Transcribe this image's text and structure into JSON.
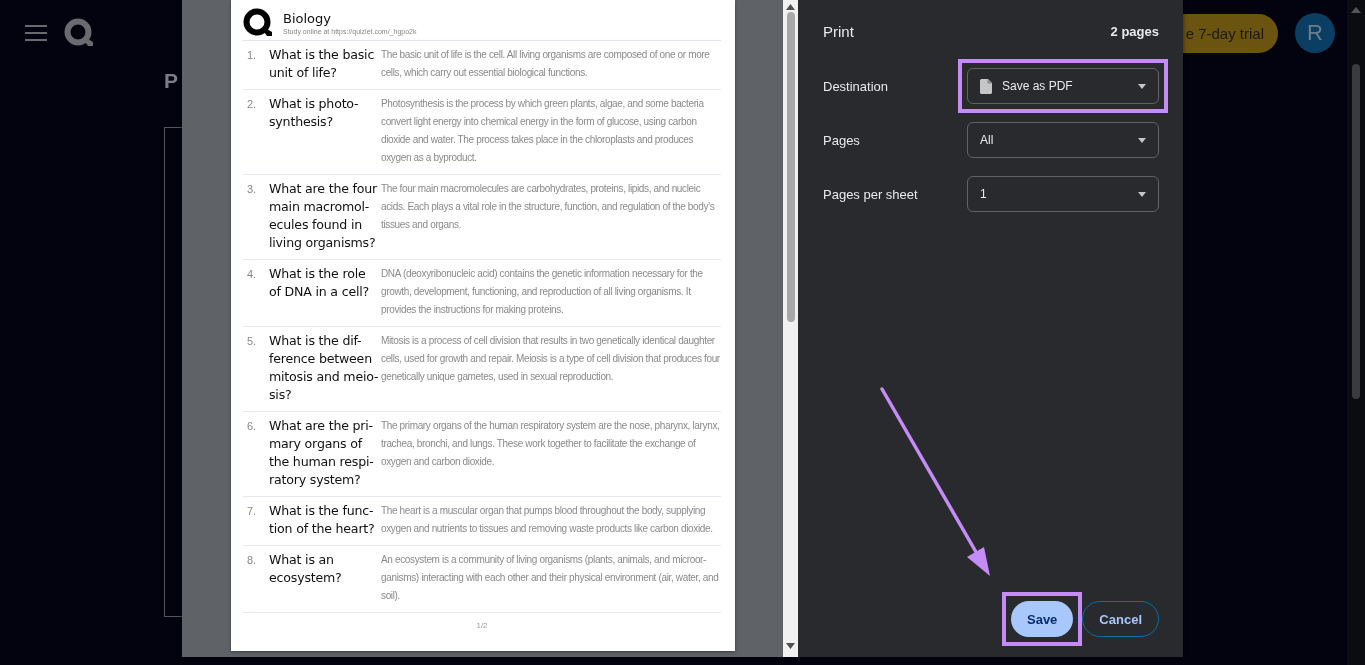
{
  "background_page": {
    "title_fragment": "P",
    "trial_button": "e 7-day trial",
    "avatar": "R"
  },
  "preview": {
    "document": {
      "title": "Biology",
      "subtitle": "Study online at https://quizlet.com/_hgpo2k",
      "items": [
        {
          "number": "1.",
          "question": "What is the basic unit of life?",
          "answer": "The basic unit of life is the cell. All living organisms are composed of one or more cells, which carry out essential biological functions."
        },
        {
          "number": "2.",
          "question": "What is photo-synthesis?",
          "answer": "Photosynthesis is the process by which green plants, algae, and some bacteria convert light energy into chemical energy in the form of glucose, using carbon dioxide and water. The process takes place in the chloroplasts and produces oxygen as a byproduct."
        },
        {
          "number": "3.",
          "question": "What are the four main macromol-ecules found in living organisms?",
          "answer": "The four main macromolecules are carbohydrates, proteins, lipids, and nucleic acids. Each plays a vital role in the structure, function, and regulation of the body's tissues and organs."
        },
        {
          "number": "4.",
          "question": "What is the role of DNA in a cell?",
          "answer": "DNA (deoxyribonucleic acid) contains the genetic information necessary for the growth, development, functioning, and reproduction of all living organisms. It provides the instructions for making proteins."
        },
        {
          "number": "5.",
          "question": "What is the dif-ference between mitosis and meio-sis?",
          "answer": "Mitosis is a process of cell division that results in two genetically identical daughter cells, used for growth and repair. Meiosis is a type of cell division that produces four genetically unique gametes, used in sexual reproduction."
        },
        {
          "number": "6.",
          "question": "What are the pri-mary organs of the human respi-ratory system?",
          "answer": "The primary organs of the human respiratory system are the nose, pharynx, larynx, trachea, bronchi, and lungs. These work together to facilitate the exchange of oxygen and carbon dioxide."
        },
        {
          "number": "7.",
          "question": "What is the func-tion of the heart?",
          "answer": "The heart is a muscular organ that pumps blood throughout the body, supplying oxygen and nutrients to tissues and removing waste products like carbon dioxide."
        },
        {
          "number": "8.",
          "question": "What is an ecosystem?",
          "answer": "An ecosystem is a community of living organisms (plants, animals, and microor-ganisms) interacting with each other and their physical environment (air, water, and soil)."
        }
      ]
    },
    "page_number": "1/2"
  },
  "print_settings": {
    "title": "Print",
    "page_count": "2 pages",
    "fields": [
      {
        "label": "Destination",
        "value": "Save as PDF",
        "kind": "file",
        "highlighted": true
      },
      {
        "label": "Pages",
        "value": "All",
        "kind": "plain",
        "highlighted": false
      },
      {
        "label": "Pages per sheet",
        "value": "1",
        "kind": "plain",
        "highlighted": false
      }
    ],
    "buttons": [
      {
        "label": "Save",
        "kind": "primary",
        "highlighted": true
      },
      {
        "label": "Cancel",
        "kind": "secondary",
        "highlighted": false
      }
    ]
  }
}
